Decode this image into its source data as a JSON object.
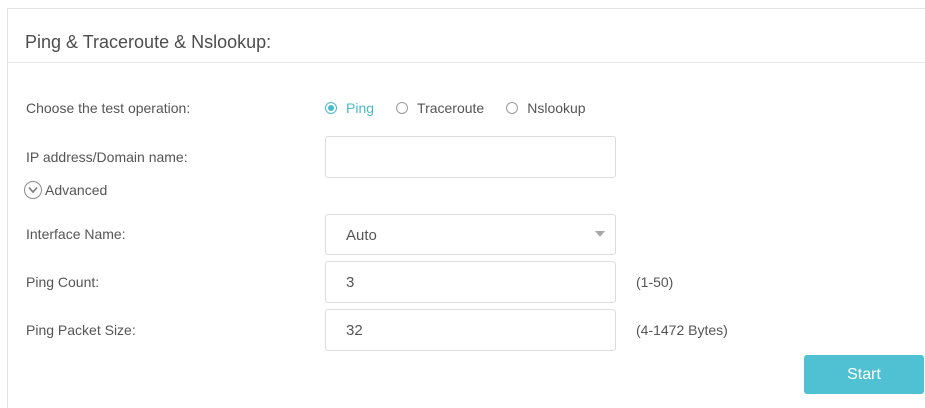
{
  "section": {
    "title": "Ping & Traceroute & Nslookup:"
  },
  "test_operation": {
    "label": "Choose the test operation:",
    "options": [
      {
        "label": "Ping",
        "checked": true
      },
      {
        "label": "Traceroute",
        "checked": false
      },
      {
        "label": "Nslookup",
        "checked": false
      }
    ]
  },
  "ip_address": {
    "label": "IP address/Domain name:",
    "value": "",
    "placeholder": ""
  },
  "advanced": {
    "label": "Advanced",
    "icon": "chevron-down-circle-icon"
  },
  "interface_name": {
    "label": "Interface Name:",
    "value": "Auto"
  },
  "ping_count": {
    "label": "Ping Count:",
    "value": "3",
    "hint": "(1-50)"
  },
  "ping_packet_size": {
    "label": "Ping Packet Size:",
    "value": "32",
    "hint": "(4-1472 Bytes)"
  },
  "actions": {
    "start_label": "Start"
  },
  "colors": {
    "accent": "#4ab9c9",
    "button": "#4fc1d2"
  }
}
